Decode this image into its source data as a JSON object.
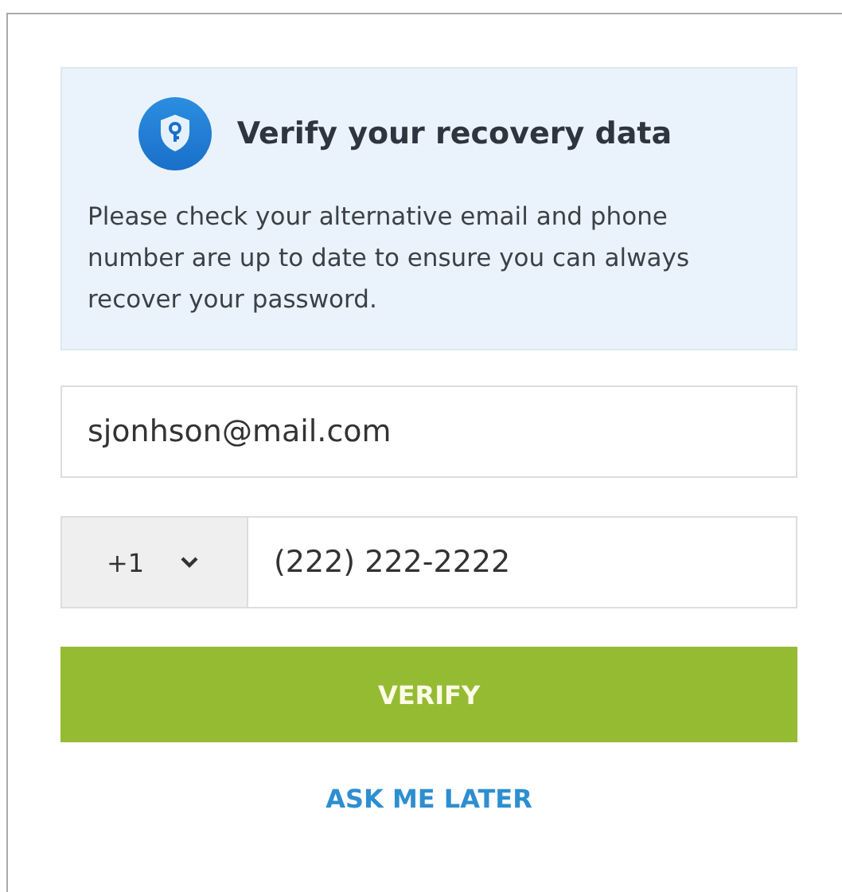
{
  "notice": {
    "title": "Verify your recovery data",
    "message": "Please check your alternative email and phone number are up to date to ensure you can always recover your password."
  },
  "email": {
    "value": "sjonhson@mail.com"
  },
  "phone": {
    "country_code": "+1",
    "value": "(222) 222-2222"
  },
  "buttons": [
    {
      "kind": "primary",
      "label": "VERIFY"
    },
    {
      "kind": "link",
      "label": "ASK ME LATER"
    }
  ]
}
